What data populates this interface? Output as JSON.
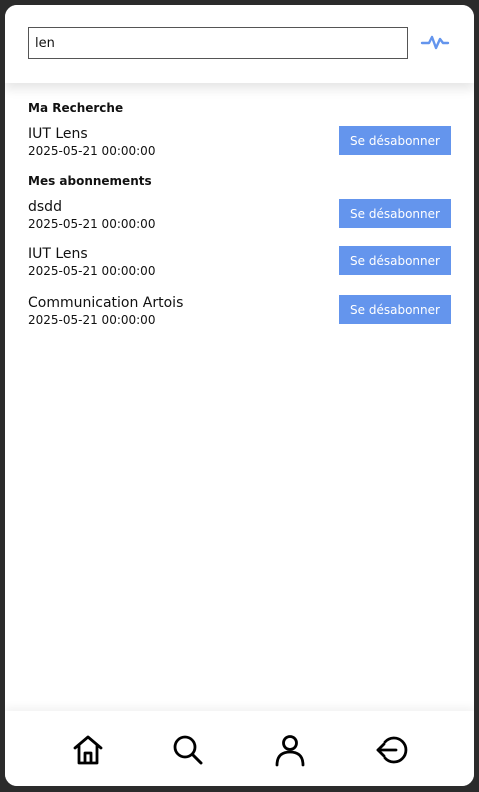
{
  "search": {
    "value": "len",
    "placeholder": ""
  },
  "header": {
    "activity_icon": "pulse-icon",
    "accent_color": "#6495ed"
  },
  "my_search": {
    "title": "Ma Recherche",
    "items": [
      {
        "name": "IUT Lens",
        "date": "2025-05-21 00:00:00",
        "button_label": "Se désabonner"
      }
    ]
  },
  "subscriptions": {
    "title": "Mes abonnements",
    "items": [
      {
        "name": "dsdd",
        "date": "2025-05-21 00:00:00",
        "button_label": "Se désabonner"
      },
      {
        "name": "IUT Lens",
        "date": "2025-05-21 00:00:00",
        "button_label": "Se désabonner"
      },
      {
        "name": "Communication Artois",
        "date": "2025-05-21 00:00:00",
        "button_label": "Se désabonner"
      }
    ]
  },
  "nav": {
    "items": [
      {
        "icon": "home-icon"
      },
      {
        "icon": "search-icon"
      },
      {
        "icon": "user-icon"
      },
      {
        "icon": "logout-icon"
      }
    ]
  }
}
